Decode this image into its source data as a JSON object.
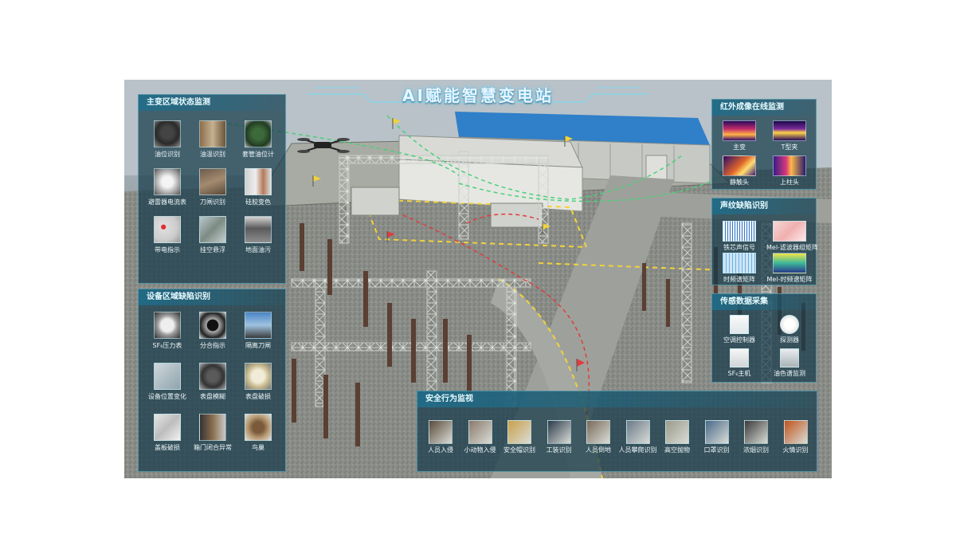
{
  "app": {
    "title": "AI赋能智慧变电站"
  },
  "panels": {
    "main_transformer": {
      "title": "主变区域状态监测",
      "items": [
        {
          "label": "油位识别",
          "icon": "oil-level-meter-icon"
        },
        {
          "label": "油温识别",
          "icon": "oil-temperature-gauge-icon"
        },
        {
          "label": "套管油位计",
          "icon": "bushing-oil-gauge-icon"
        },
        {
          "label": "避雷器电流表",
          "icon": "arrester-ammeter-icon"
        },
        {
          "label": "刀闸识别",
          "icon": "disconnector-icon"
        },
        {
          "label": "硅胶变色",
          "icon": "silica-gel-icon"
        },
        {
          "label": "带电指示",
          "icon": "live-indicator-icon"
        },
        {
          "label": "挂空悬浮",
          "icon": "suspended-object-icon"
        },
        {
          "label": "地面油污",
          "icon": "ground-oil-stain-icon"
        }
      ]
    },
    "equipment_defect": {
      "title": "设备区域缺陷识别",
      "items": [
        {
          "label": "SF₆压力表",
          "icon": "sf6-pressure-gauge-icon"
        },
        {
          "label": "分合指示",
          "icon": "open-close-indicator-icon"
        },
        {
          "label": "隔离刀闸",
          "icon": "isolation-switch-icon"
        },
        {
          "label": "设备位置变化",
          "icon": "device-position-icon"
        },
        {
          "label": "表盘模糊",
          "icon": "blurred-dial-icon"
        },
        {
          "label": "表盘破损",
          "icon": "damaged-dial-icon"
        },
        {
          "label": "盖板破损",
          "icon": "damaged-cover-icon"
        },
        {
          "label": "箱门闭合异常",
          "icon": "cabinet-door-icon"
        },
        {
          "label": "鸟巢",
          "icon": "bird-nest-icon"
        }
      ]
    },
    "infrared": {
      "title": "红外成像在线监测",
      "items": [
        {
          "label": "主变",
          "icon": "thermal-main-transformer-icon"
        },
        {
          "label": "T型夹",
          "icon": "thermal-t-clamp-icon"
        },
        {
          "label": "静触头",
          "icon": "thermal-static-contact-icon"
        },
        {
          "label": "上柱头",
          "icon": "thermal-upper-post-icon"
        }
      ]
    },
    "voiceprint": {
      "title": "声纹缺陷识别",
      "items": [
        {
          "label": "铁芯声信号",
          "icon": "core-signal-icon"
        },
        {
          "label": "Mel-滤波器组矩阵",
          "icon": "mel-filter-matrix-icon"
        },
        {
          "label": "时频谱矩阵",
          "icon": "spectrogram-icon"
        },
        {
          "label": "Mel-时频谱矩阵",
          "icon": "mel-spectrogram-icon"
        }
      ]
    },
    "sensor": {
      "title": "传感数据采集",
      "items": [
        {
          "label": "空调控制器",
          "icon": "ac-controller-icon"
        },
        {
          "label": "探测器",
          "icon": "smoke-detector-icon"
        },
        {
          "label": "SF₆主机",
          "icon": "sf6-host-icon"
        },
        {
          "label": "油色谱监测",
          "icon": "oil-chromatography-icon"
        }
      ]
    },
    "guard": {
      "title": "安全行为监视",
      "items": [
        {
          "label": "人员入侵",
          "icon": "person-intrusion-icon"
        },
        {
          "label": "小动物入侵",
          "icon": "animal-intrusion-icon"
        },
        {
          "label": "安全帽识别",
          "icon": "safety-helmet-icon"
        },
        {
          "label": "工装识别",
          "icon": "work-uniform-icon"
        },
        {
          "label": "人员倒地",
          "icon": "person-fall-icon"
        },
        {
          "label": "人员攀爬识别",
          "icon": "person-climb-icon"
        },
        {
          "label": "高空抛物",
          "icon": "falling-object-icon"
        },
        {
          "label": "口罩识别",
          "icon": "mask-icon"
        },
        {
          "label": "浓烟识别",
          "icon": "smoke-icon"
        },
        {
          "label": "火情识别",
          "icon": "fire-icon"
        }
      ]
    }
  },
  "colors": {
    "panel_bg": "#163a4a",
    "panel_border": "#6ec8e1",
    "roof": "#2f7fc9",
    "path_green": "#4ad07a",
    "path_red": "#e23b3b",
    "warning_yellow": "#f2d23a"
  }
}
